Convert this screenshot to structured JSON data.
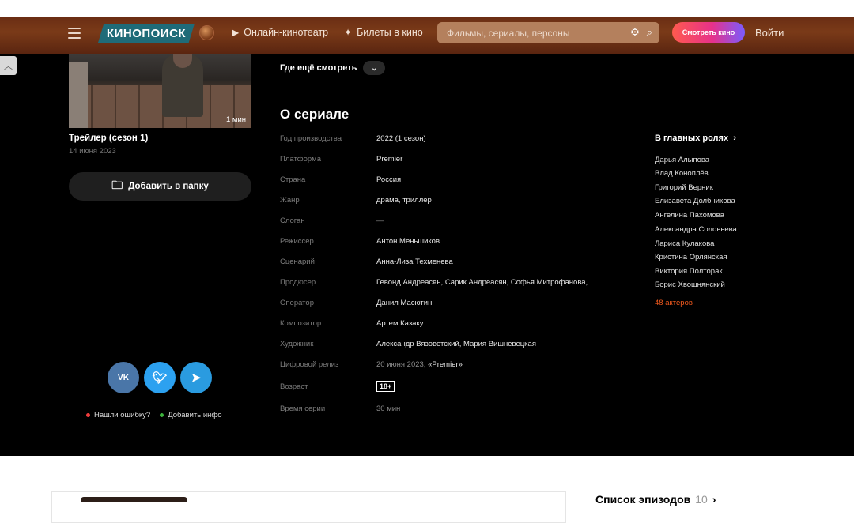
{
  "header": {
    "logo": "КИНОПОИСК",
    "nav_online": "Онлайн-кинотеатр",
    "nav_tickets": "Билеты в кино",
    "search_placeholder": "Фильмы, сериалы, персоны",
    "watch_button": "Смотреть кино",
    "login": "Войти"
  },
  "trailer": {
    "duration": "1 мин",
    "title": "Трейлер (сезон 1)",
    "date": "14 июня 2023"
  },
  "sidebar": {
    "add_folder": "Добавить в папку",
    "social": [
      "VK",
      "Twitter",
      "Telegram"
    ],
    "report_error": "Нашли ошибку?",
    "add_info": "Добавить инфо"
  },
  "where_watch": "Где ещё смотреть",
  "about": {
    "title": "О сериале",
    "rows": [
      {
        "label": "Год производства",
        "value": "2022 (1 сезон)"
      },
      {
        "label": "Платформа",
        "value": "Premier"
      },
      {
        "label": "Страна",
        "value": "Россия"
      },
      {
        "label": "Жанр",
        "value": "драма, триллер"
      },
      {
        "label": "Слоган",
        "value": "—"
      },
      {
        "label": "Режиссер",
        "value": "Антон Меньшиков"
      },
      {
        "label": "Сценарий",
        "value": "Анна-Лиза Техменева"
      },
      {
        "label": "Продюсер",
        "value": "Гевонд Андреасян, Сарик Андреасян, Софья Митрофанова, ..."
      },
      {
        "label": "Оператор",
        "value": "Данил Масютин"
      },
      {
        "label": "Композитор",
        "value": "Артем Казаку"
      },
      {
        "label": "Художник",
        "value": "Александр Вязоветский, Мария Вишневецкая"
      },
      {
        "label": "Цифровой релиз",
        "value": "20 июня 2023,",
        "value_extra": "«Premier»"
      },
      {
        "label": "Возраст",
        "value": "18+"
      },
      {
        "label": "Время серии",
        "value": "30 мин"
      }
    ]
  },
  "cast": {
    "title": "В главных ролях",
    "actors": [
      "Дарья Алыпова",
      "Влад Коноплёв",
      "Григорий Верник",
      "Елизавета Долбникова",
      "Ангелина Пахомова",
      "Александра Соловьева",
      "Лариса Кулакова",
      "Кристина Орлянская",
      "Виктория Полторак",
      "Борис Хвошнянский"
    ],
    "more": "48 актеров"
  },
  "episodes": {
    "label": "Список эпизодов",
    "count": "10"
  },
  "colors": {
    "accent": "#f25a1e",
    "background": "#000000",
    "header": "#6b2e14"
  }
}
